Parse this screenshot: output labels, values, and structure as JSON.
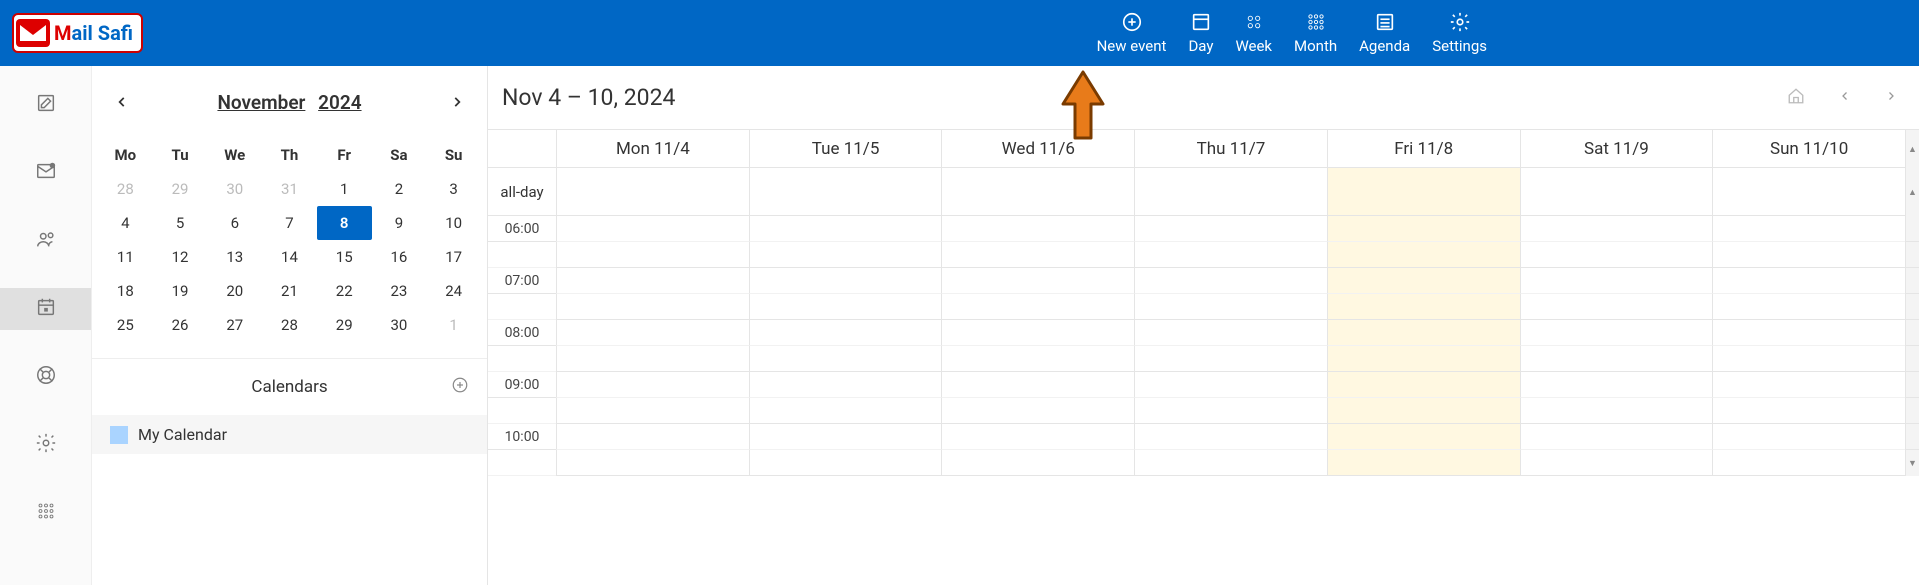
{
  "logo": {
    "brand": "Mail Safi"
  },
  "header": {
    "nav": [
      {
        "id": "new-event",
        "label": "New event",
        "icon": "plus-circle"
      },
      {
        "id": "day",
        "label": "Day",
        "icon": "day"
      },
      {
        "id": "week",
        "label": "Week",
        "icon": "week"
      },
      {
        "id": "month",
        "label": "Month",
        "icon": "month"
      },
      {
        "id": "agenda",
        "label": "Agenda",
        "icon": "agenda"
      },
      {
        "id": "settings",
        "label": "Settings",
        "icon": "gear"
      }
    ]
  },
  "rail": [
    {
      "id": "compose",
      "icon": "compose"
    },
    {
      "id": "mail",
      "icon": "envelope-badge"
    },
    {
      "id": "contacts",
      "icon": "contacts"
    },
    {
      "id": "calendar",
      "icon": "calendar",
      "active": true
    },
    {
      "id": "help",
      "icon": "life-ring"
    },
    {
      "id": "settings",
      "icon": "gear"
    },
    {
      "id": "apps",
      "icon": "grid"
    }
  ],
  "miniCalendar": {
    "monthLabel": "November",
    "yearLabel": "2024",
    "dow": [
      "Mo",
      "Tu",
      "We",
      "Th",
      "Fr",
      "Sa",
      "Su"
    ],
    "weeks": [
      [
        {
          "d": "28",
          "muted": true
        },
        {
          "d": "29",
          "muted": true
        },
        {
          "d": "30",
          "muted": true
        },
        {
          "d": "31",
          "muted": true
        },
        {
          "d": "1"
        },
        {
          "d": "2"
        },
        {
          "d": "3"
        }
      ],
      [
        {
          "d": "4"
        },
        {
          "d": "5"
        },
        {
          "d": "6"
        },
        {
          "d": "7"
        },
        {
          "d": "8",
          "selected": true
        },
        {
          "d": "9"
        },
        {
          "d": "10"
        }
      ],
      [
        {
          "d": "11"
        },
        {
          "d": "12"
        },
        {
          "d": "13"
        },
        {
          "d": "14"
        },
        {
          "d": "15"
        },
        {
          "d": "16"
        },
        {
          "d": "17"
        }
      ],
      [
        {
          "d": "18"
        },
        {
          "d": "19"
        },
        {
          "d": "20"
        },
        {
          "d": "21"
        },
        {
          "d": "22"
        },
        {
          "d": "23"
        },
        {
          "d": "24"
        }
      ],
      [
        {
          "d": "25"
        },
        {
          "d": "26"
        },
        {
          "d": "27"
        },
        {
          "d": "28"
        },
        {
          "d": "29"
        },
        {
          "d": "30"
        },
        {
          "d": "1",
          "muted": true
        }
      ]
    ]
  },
  "calendars": {
    "heading": "Calendars",
    "items": [
      {
        "name": "My Calendar",
        "color": "#aad4ff"
      }
    ]
  },
  "main": {
    "rangeTitle": "Nov 4 – 10, 2024",
    "days": [
      "Mon 11/4",
      "Tue 11/5",
      "Wed 11/6",
      "Thu 11/7",
      "Fri 11/8",
      "Sat 11/9",
      "Sun 11/10"
    ],
    "todayIndex": 4,
    "alldayLabel": "all-day",
    "hours": [
      "06:00",
      "07:00",
      "08:00",
      "09:00",
      "10:00"
    ]
  }
}
